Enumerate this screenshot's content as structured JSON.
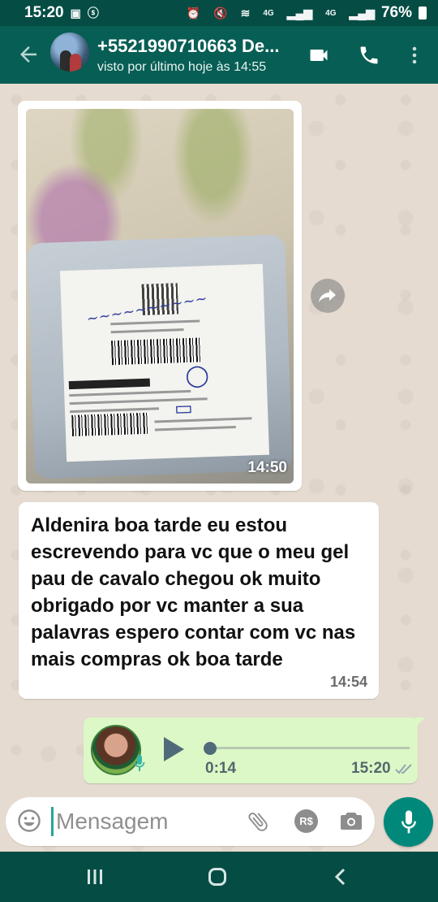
{
  "status_bar": {
    "time": "15:20",
    "battery": "76%",
    "network_labels": [
      "4G",
      "4G"
    ]
  },
  "header": {
    "contact_name": "+5521990710663 De...",
    "last_seen": "visto por último hoje às 14:55"
  },
  "messages": [
    {
      "type": "image",
      "direction": "incoming",
      "time": "14:50",
      "icon": "package-photo"
    },
    {
      "type": "text",
      "direction": "incoming",
      "text": "Aldenira boa tarde eu estou escrevendo para vc que o meu gel pau de cavalo chegou ok muito obrigado por vc manter a sua palavras espero contar com vc nas mais compras ok boa tarde",
      "time": "14:54"
    },
    {
      "type": "voice",
      "direction": "outgoing",
      "duration": "0:14",
      "time": "15:20",
      "progress": 0.0,
      "status_icon": "double-check-icon"
    }
  ],
  "input": {
    "placeholder": "Mensagem",
    "payment_label": "R$"
  },
  "colors": {
    "header": "#075e54",
    "status_bar": "#054d44",
    "accent": "#00897b",
    "outgoing_bubble": "#dcf8c6",
    "incoming_bubble": "#ffffff"
  }
}
